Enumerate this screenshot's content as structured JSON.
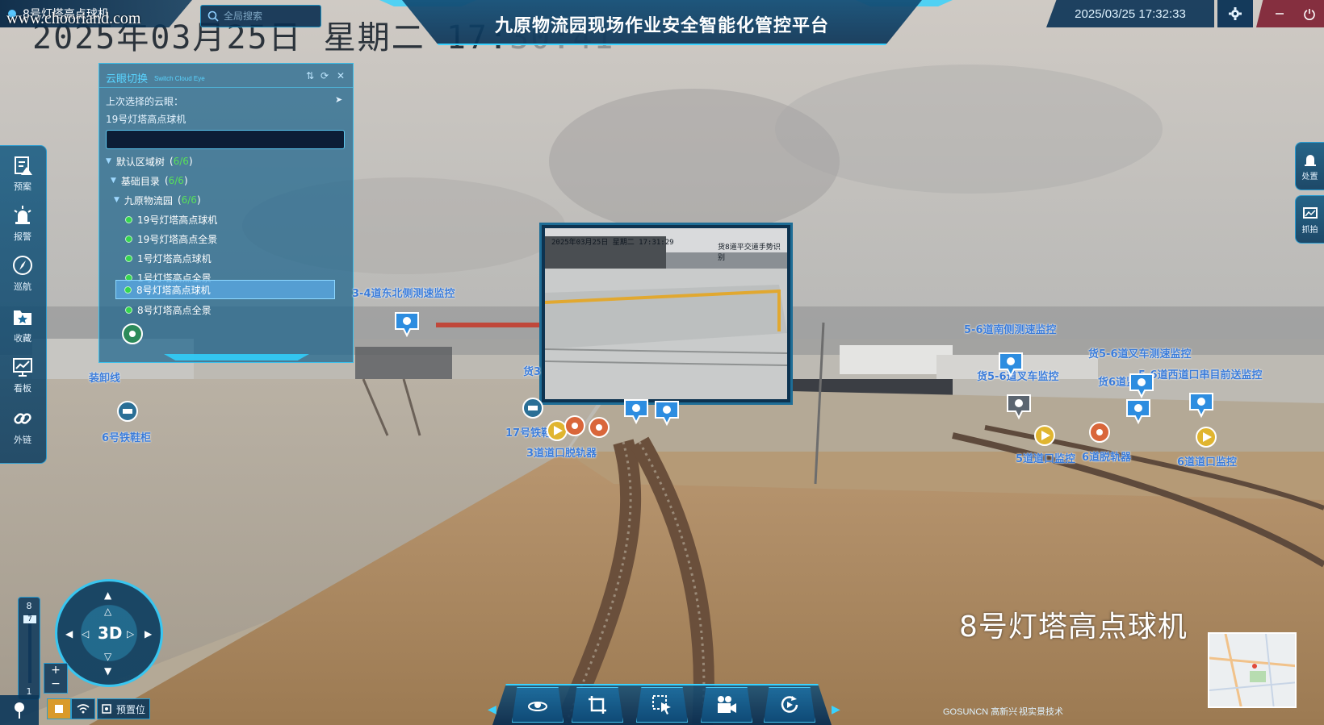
{
  "window": {
    "camera_tab": "8号灯塔高点球机",
    "search_placeholder": "全局搜索",
    "title": "九原物流园现场作业安全智能化管控平台",
    "datetime": "2025/03/25 17:32:33",
    "watermark": "www.chooriand.com"
  },
  "osd": {
    "date_text": "2025年03月25日 星期二 17:",
    "time_tail": "30:41",
    "camera_name": "8号灯塔高点球机"
  },
  "left_rail": [
    {
      "label": "预案",
      "icon": "plan-icon"
    },
    {
      "label": "报警",
      "icon": "alarm-icon"
    },
    {
      "label": "巡航",
      "icon": "compass-icon"
    },
    {
      "label": "收藏",
      "icon": "star-folder-icon"
    },
    {
      "label": "看板",
      "icon": "chart-board-icon"
    },
    {
      "label": "外链",
      "icon": "link-icon"
    }
  ],
  "right_tabs": [
    {
      "label": "处置",
      "icon": "handle-icon"
    },
    {
      "label": "抓拍",
      "icon": "snapshot-icon"
    }
  ],
  "panel": {
    "title": "云眼切换",
    "title_en": "Switch Cloud Eye",
    "last_selected_label": "上次选择的云眼：",
    "last_selected_value": "19号灯塔高点球机",
    "tree": [
      {
        "label": "默认区域树",
        "count": "6/6",
        "level": 0
      },
      {
        "label": "基础目录",
        "count": "6/6",
        "level": 1
      },
      {
        "label": "九原物流园",
        "count": "6/6",
        "level": 2
      }
    ],
    "cameras": [
      "19号灯塔高点球机",
      "19号灯塔高点全景",
      "1号灯塔高点球机",
      "1号灯塔高点全景",
      "8号灯塔高点球机",
      "8号灯塔高点全景"
    ],
    "selected_camera": "8号灯塔高点球机"
  },
  "popup": {
    "osd_time": "2025年03月25日 星期二 17:31:29",
    "osd_label": "货8道平交道手势识别"
  },
  "map_labels": [
    "3-4道东北侧测速监控",
    "5-6道南侧测速监控",
    "货5-6道叉车测速监控",
    "5-6道西道口串目前送监控",
    "货6道监控",
    "货5-6道叉车监控",
    "装卸线",
    "6号铁鞋柜",
    "17号铁鞋柜",
    "3道道口脱轨器",
    "5道道口监控",
    "6道脱轨器",
    "6道道口监控",
    "货3"
  ],
  "zoom": {
    "max": "8",
    "current": "7",
    "min": "1"
  },
  "compass_label": "3D",
  "bottom": {
    "preset_label": "预置位",
    "brand1": "GOSUNCN 高新兴",
    "brand2": "视实景技术"
  },
  "colors": {
    "accent": "#39d2ff",
    "panel_bg": "#1c648c",
    "ok_green": "#35d64f",
    "label_blue": "#3a7bd8"
  }
}
